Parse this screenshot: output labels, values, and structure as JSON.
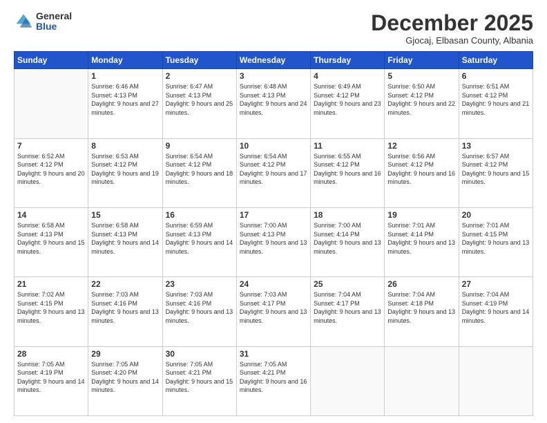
{
  "logo": {
    "general": "General",
    "blue": "Blue"
  },
  "title": "December 2025",
  "location": "Gjocaj, Elbasan County, Albania",
  "days_of_week": [
    "Sunday",
    "Monday",
    "Tuesday",
    "Wednesday",
    "Thursday",
    "Friday",
    "Saturday"
  ],
  "weeks": [
    [
      {
        "day": "",
        "sunrise": "",
        "sunset": "",
        "daylight": ""
      },
      {
        "day": "1",
        "sunrise": "Sunrise: 6:46 AM",
        "sunset": "Sunset: 4:13 PM",
        "daylight": "Daylight: 9 hours and 27 minutes."
      },
      {
        "day": "2",
        "sunrise": "Sunrise: 6:47 AM",
        "sunset": "Sunset: 4:13 PM",
        "daylight": "Daylight: 9 hours and 25 minutes."
      },
      {
        "day": "3",
        "sunrise": "Sunrise: 6:48 AM",
        "sunset": "Sunset: 4:13 PM",
        "daylight": "Daylight: 9 hours and 24 minutes."
      },
      {
        "day": "4",
        "sunrise": "Sunrise: 6:49 AM",
        "sunset": "Sunset: 4:12 PM",
        "daylight": "Daylight: 9 hours and 23 minutes."
      },
      {
        "day": "5",
        "sunrise": "Sunrise: 6:50 AM",
        "sunset": "Sunset: 4:12 PM",
        "daylight": "Daylight: 9 hours and 22 minutes."
      },
      {
        "day": "6",
        "sunrise": "Sunrise: 6:51 AM",
        "sunset": "Sunset: 4:12 PM",
        "daylight": "Daylight: 9 hours and 21 minutes."
      }
    ],
    [
      {
        "day": "7",
        "sunrise": "Sunrise: 6:52 AM",
        "sunset": "Sunset: 4:12 PM",
        "daylight": "Daylight: 9 hours and 20 minutes."
      },
      {
        "day": "8",
        "sunrise": "Sunrise: 6:53 AM",
        "sunset": "Sunset: 4:12 PM",
        "daylight": "Daylight: 9 hours and 19 minutes."
      },
      {
        "day": "9",
        "sunrise": "Sunrise: 6:54 AM",
        "sunset": "Sunset: 4:12 PM",
        "daylight": "Daylight: 9 hours and 18 minutes."
      },
      {
        "day": "10",
        "sunrise": "Sunrise: 6:54 AM",
        "sunset": "Sunset: 4:12 PM",
        "daylight": "Daylight: 9 hours and 17 minutes."
      },
      {
        "day": "11",
        "sunrise": "Sunrise: 6:55 AM",
        "sunset": "Sunset: 4:12 PM",
        "daylight": "Daylight: 9 hours and 16 minutes."
      },
      {
        "day": "12",
        "sunrise": "Sunrise: 6:56 AM",
        "sunset": "Sunset: 4:12 PM",
        "daylight": "Daylight: 9 hours and 16 minutes."
      },
      {
        "day": "13",
        "sunrise": "Sunrise: 6:57 AM",
        "sunset": "Sunset: 4:12 PM",
        "daylight": "Daylight: 9 hours and 15 minutes."
      }
    ],
    [
      {
        "day": "14",
        "sunrise": "Sunrise: 6:58 AM",
        "sunset": "Sunset: 4:13 PM",
        "daylight": "Daylight: 9 hours and 15 minutes."
      },
      {
        "day": "15",
        "sunrise": "Sunrise: 6:58 AM",
        "sunset": "Sunset: 4:13 PM",
        "daylight": "Daylight: 9 hours and 14 minutes."
      },
      {
        "day": "16",
        "sunrise": "Sunrise: 6:59 AM",
        "sunset": "Sunset: 4:13 PM",
        "daylight": "Daylight: 9 hours and 14 minutes."
      },
      {
        "day": "17",
        "sunrise": "Sunrise: 7:00 AM",
        "sunset": "Sunset: 4:13 PM",
        "daylight": "Daylight: 9 hours and 13 minutes."
      },
      {
        "day": "18",
        "sunrise": "Sunrise: 7:00 AM",
        "sunset": "Sunset: 4:14 PM",
        "daylight": "Daylight: 9 hours and 13 minutes."
      },
      {
        "day": "19",
        "sunrise": "Sunrise: 7:01 AM",
        "sunset": "Sunset: 4:14 PM",
        "daylight": "Daylight: 9 hours and 13 minutes."
      },
      {
        "day": "20",
        "sunrise": "Sunrise: 7:01 AM",
        "sunset": "Sunset: 4:15 PM",
        "daylight": "Daylight: 9 hours and 13 minutes."
      }
    ],
    [
      {
        "day": "21",
        "sunrise": "Sunrise: 7:02 AM",
        "sunset": "Sunset: 4:15 PM",
        "daylight": "Daylight: 9 hours and 13 minutes."
      },
      {
        "day": "22",
        "sunrise": "Sunrise: 7:03 AM",
        "sunset": "Sunset: 4:16 PM",
        "daylight": "Daylight: 9 hours and 13 minutes."
      },
      {
        "day": "23",
        "sunrise": "Sunrise: 7:03 AM",
        "sunset": "Sunset: 4:16 PM",
        "daylight": "Daylight: 9 hours and 13 minutes."
      },
      {
        "day": "24",
        "sunrise": "Sunrise: 7:03 AM",
        "sunset": "Sunset: 4:17 PM",
        "daylight": "Daylight: 9 hours and 13 minutes."
      },
      {
        "day": "25",
        "sunrise": "Sunrise: 7:04 AM",
        "sunset": "Sunset: 4:17 PM",
        "daylight": "Daylight: 9 hours and 13 minutes."
      },
      {
        "day": "26",
        "sunrise": "Sunrise: 7:04 AM",
        "sunset": "Sunset: 4:18 PM",
        "daylight": "Daylight: 9 hours and 13 minutes."
      },
      {
        "day": "27",
        "sunrise": "Sunrise: 7:04 AM",
        "sunset": "Sunset: 4:19 PM",
        "daylight": "Daylight: 9 hours and 14 minutes."
      }
    ],
    [
      {
        "day": "28",
        "sunrise": "Sunrise: 7:05 AM",
        "sunset": "Sunset: 4:19 PM",
        "daylight": "Daylight: 9 hours and 14 minutes."
      },
      {
        "day": "29",
        "sunrise": "Sunrise: 7:05 AM",
        "sunset": "Sunset: 4:20 PM",
        "daylight": "Daylight: 9 hours and 14 minutes."
      },
      {
        "day": "30",
        "sunrise": "Sunrise: 7:05 AM",
        "sunset": "Sunset: 4:21 PM",
        "daylight": "Daylight: 9 hours and 15 minutes."
      },
      {
        "day": "31",
        "sunrise": "Sunrise: 7:05 AM",
        "sunset": "Sunset: 4:21 PM",
        "daylight": "Daylight: 9 hours and 16 minutes."
      },
      {
        "day": "",
        "sunrise": "",
        "sunset": "",
        "daylight": ""
      },
      {
        "day": "",
        "sunrise": "",
        "sunset": "",
        "daylight": ""
      },
      {
        "day": "",
        "sunrise": "",
        "sunset": "",
        "daylight": ""
      }
    ]
  ]
}
